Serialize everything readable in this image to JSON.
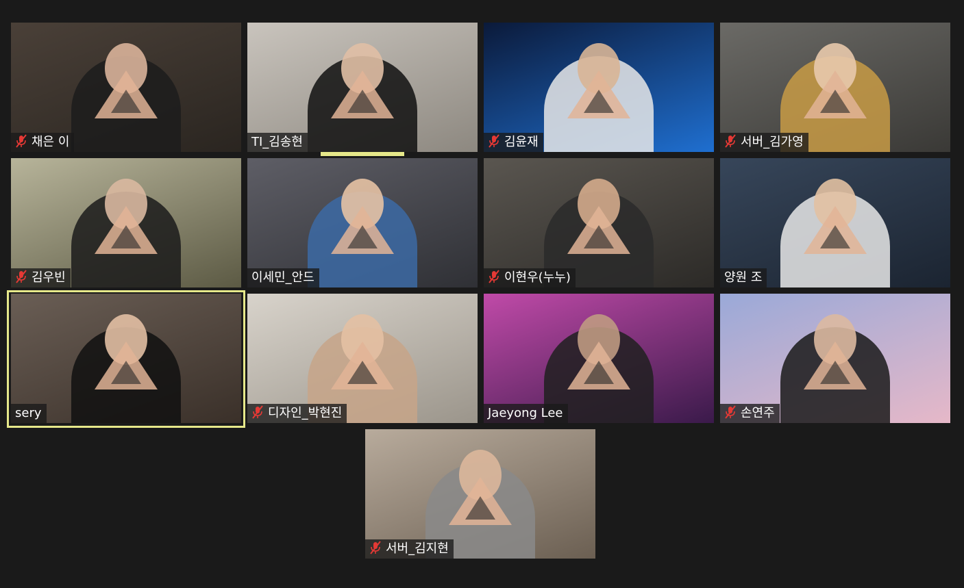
{
  "app": "video-conference-gallery-view",
  "active_speaker": "sery",
  "colors": {
    "background": "#1a1a1a",
    "speaker_highlight": "#e6e88a",
    "muted_icon": "#e53935",
    "nameplate_bg": "#1a1a1a",
    "name_text": "#ffffff"
  },
  "participants": [
    {
      "name": "채은 이",
      "muted": true,
      "icon": "microphone-muted-icon",
      "bg1": "#4a4038",
      "bg2": "#2a2520",
      "skin": "#d9b39a",
      "shirt": "#1c1c1c"
    },
    {
      "name": "TI_김송현",
      "muted": false,
      "icon": "",
      "bg1": "#c9c4bd",
      "bg2": "#8d8880",
      "skin": "#e0bfa5",
      "shirt": "#101010"
    },
    {
      "name": "김윤재",
      "muted": true,
      "icon": "microphone-muted-icon",
      "bg1": "#0b1a3a",
      "bg2": "#1f6fd0",
      "skin": "#d8b596",
      "shirt": "#e8e8e8"
    },
    {
      "name": "서버_김가영",
      "muted": true,
      "icon": "microphone-muted-icon",
      "bg1": "#6b6a66",
      "bg2": "#3a3936",
      "skin": "#e8c9ac",
      "shirt": "#c89b45"
    },
    {
      "name": "김우빈",
      "muted": true,
      "icon": "microphone-muted-icon",
      "bg1": "#b7b49a",
      "bg2": "#5c5a44",
      "skin": "#d9b8a0",
      "shirt": "#1b1b1b"
    },
    {
      "name": "이세민_안드",
      "muted": false,
      "icon": "",
      "bg1": "#5e5e66",
      "bg2": "#2f3035",
      "skin": "#e6c2a4",
      "shirt": "#3c6aa5"
    },
    {
      "name": "이현우(누누)",
      "muted": true,
      "icon": "microphone-muted-icon",
      "bg1": "#5a5650",
      "bg2": "#2c2a27",
      "skin": "#d4ab8c",
      "shirt": "#2a2a2a"
    },
    {
      "name": "양원 조",
      "muted": false,
      "icon": "",
      "bg1": "#37465a",
      "bg2": "#1b2431",
      "skin": "#e2c1a2",
      "shirt": "#e7e7e7"
    },
    {
      "name": "sery",
      "muted": false,
      "icon": "",
      "bg1": "#6a5e55",
      "bg2": "#3a3029",
      "skin": "#e2bfa3",
      "shirt": "#111111"
    },
    {
      "name": "디자인_박현진",
      "muted": true,
      "icon": "microphone-muted-icon",
      "bg1": "#d8d3cb",
      "bg2": "#9b958b",
      "skin": "#e3c0a3",
      "shirt": "#c7a488"
    },
    {
      "name": "Jaeyong Lee",
      "muted": false,
      "icon": "",
      "bg1": "#c04aa8",
      "bg2": "#3a1a4a",
      "skin": "#bf9a82",
      "shirt": "#202020"
    },
    {
      "name": "손연주",
      "muted": true,
      "icon": "microphone-muted-icon",
      "bg1": "#9aa9d8",
      "bg2": "#e6b8c8",
      "skin": "#dcb9a0",
      "shirt": "#1a1a1a"
    },
    {
      "name": "서버_김지현",
      "muted": true,
      "icon": "microphone-muted-icon",
      "bg1": "#b8ab9c",
      "bg2": "#6b5f52",
      "skin": "#dcb79b",
      "shirt": "#8a8a8a"
    }
  ]
}
